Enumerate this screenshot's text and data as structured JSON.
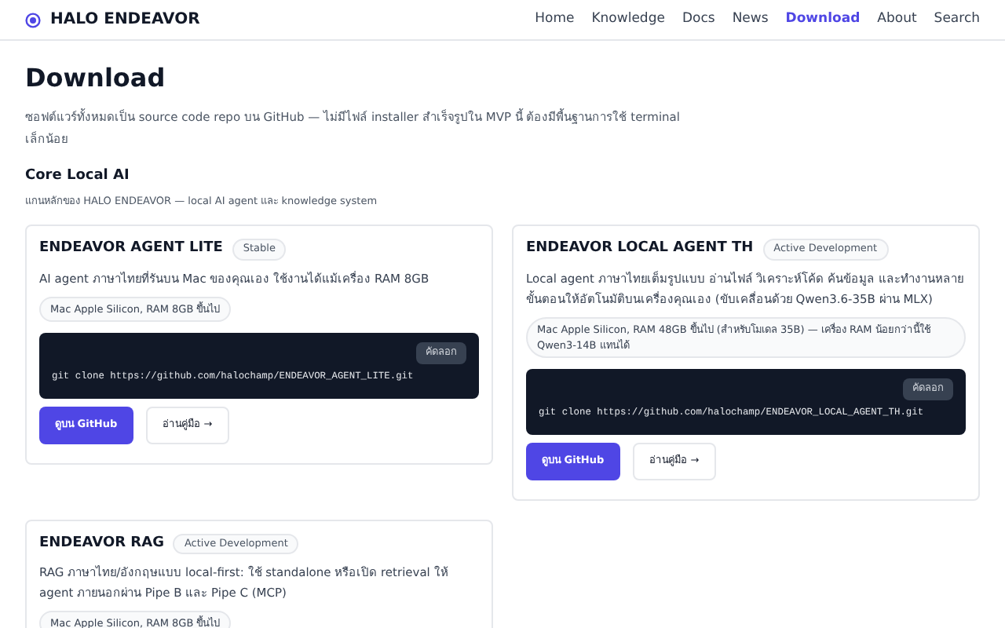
{
  "header": {
    "brand": "HALO ENDEAVOR",
    "nav": [
      {
        "label": "Home",
        "selected": false
      },
      {
        "label": "Knowledge",
        "selected": false
      },
      {
        "label": "Docs",
        "selected": false
      },
      {
        "label": "News",
        "selected": false
      },
      {
        "label": "Download",
        "selected": true
      },
      {
        "label": "About",
        "selected": false
      },
      {
        "label": "Search",
        "selected": false
      }
    ]
  },
  "page": {
    "title": "Download",
    "intro": "ซอฟต์แวร์ทั้งหมดเป็น source code repo บน GitHub — ไม่มีไฟล์ installer สำเร็จรูปใน MVP นี้ ต้องมีพื้นฐานการใช้ terminal เล็กน้อย"
  },
  "section": {
    "title": "Core Local AI",
    "subtitle": "แกนหลักของ HALO ENDEAVOR — local AI agent และ knowledge system"
  },
  "cards": [
    {
      "name": "ENDEAVOR AGENT LITE",
      "status": "Stable",
      "description": "AI agent ภาษาไทยที่รันบน Mac ของคุณเอง ใช้งานได้แม้เครื่อง RAM 8GB",
      "requirement": "Mac Apple Silicon, RAM 8GB ขึ้นไป",
      "command": "git clone https://github.com/halochamp/ENDEAVOR_AGENT_LITE.git",
      "copy_label": "คัดลอก",
      "primary_button": "ดูบน GitHub",
      "secondary_button": "อ่านคู่มือ →"
    },
    {
      "name": "ENDEAVOR LOCAL AGENT TH",
      "status": "Active Development",
      "description": "Local agent ภาษาไทยเต็มรูปแบบ อ่านไฟล์ วิเคราะห์โค้ด ค้นข้อมูล และทำงานหลายขั้นตอนให้อัตโนมัติบนเครื่องคุณเอง (ขับเคลื่อนด้วย Qwen3.6-35B ผ่าน MLX)",
      "requirement": "Mac Apple Silicon, RAM 48GB ขึ้นไป (สำหรับโมเดล 35B) — เครื่อง RAM น้อยกว่านี้ใช้ Qwen3-14B แทนได้",
      "command": "git clone https://github.com/halochamp/ENDEAVOR_LOCAL_AGENT_TH.git",
      "copy_label": "คัดลอก",
      "primary_button": "ดูบน GitHub",
      "secondary_button": "อ่านคู่มือ →"
    },
    {
      "name": "ENDEAVOR RAG",
      "status": "Active Development",
      "description": "RAG ภาษาไทย/อังกฤษแบบ local-first: ใช้ standalone หรือเปิด retrieval ให้ agent ภายนอกผ่าน Pipe B และ Pipe C (MCP)",
      "requirement": "Mac Apple Silicon, RAM 8GB ขึ้นไป"
    }
  ]
}
